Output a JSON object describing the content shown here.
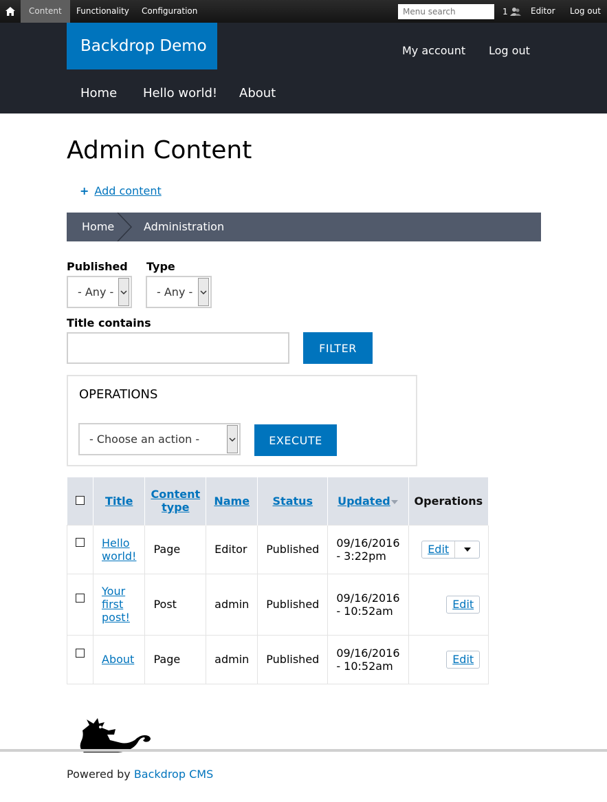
{
  "admin_bar": {
    "items": [
      "Content",
      "Functionality",
      "Configuration"
    ],
    "search_placeholder": "Menu search",
    "user_count": "1",
    "user_label": "Editor",
    "logout_label": "Log out"
  },
  "header": {
    "site_name": "Backdrop Demo",
    "account_links": [
      "My account",
      "Log out"
    ],
    "nav": [
      "Home",
      "Hello world!",
      "About"
    ]
  },
  "page": {
    "title": "Admin Content",
    "add_content_label": "Add content"
  },
  "breadcrumb": [
    "Home",
    "Administration"
  ],
  "filters": {
    "published_label": "Published",
    "published_value": "- Any -",
    "type_label": "Type",
    "type_value": "- Any -",
    "title_label": "Title contains",
    "title_value": "",
    "filter_button": "FILTER"
  },
  "operations": {
    "title": "OPERATIONS",
    "action_value": "- Choose an action -",
    "execute_button": "EXECUTE"
  },
  "table": {
    "headers": [
      "Title",
      "Content type",
      "Name",
      "Status",
      "Updated",
      "Operations"
    ],
    "rows": [
      {
        "title": "Hello world!",
        "type": "Page",
        "name": "Editor",
        "status": "Published",
        "updated": "09/16/2016 - 3:22pm",
        "op": "Edit"
      },
      {
        "title": "Your first post!",
        "type": "Post",
        "name": "admin",
        "status": "Published",
        "updated": "09/16/2016 - 10:52am",
        "op": "Edit"
      },
      {
        "title": "About",
        "type": "Page",
        "name": "admin",
        "status": "Published",
        "updated": "09/16/2016 - 10:52am",
        "op": "Edit"
      }
    ]
  },
  "footer": {
    "powered_prefix": "Powered by",
    "powered_link": "Backdrop CMS"
  },
  "colors": {
    "brand": "#0074bd",
    "header_bg": "#21252d",
    "breadcrumb_bg": "#515a6b",
    "table_header_bg": "#dde1e8"
  },
  "icons": {
    "home": "home-icon",
    "users": "users-icon",
    "plus": "plus-icon",
    "dropdown": "chevron-down-icon",
    "logo": "backdrop-dragon-logo"
  }
}
